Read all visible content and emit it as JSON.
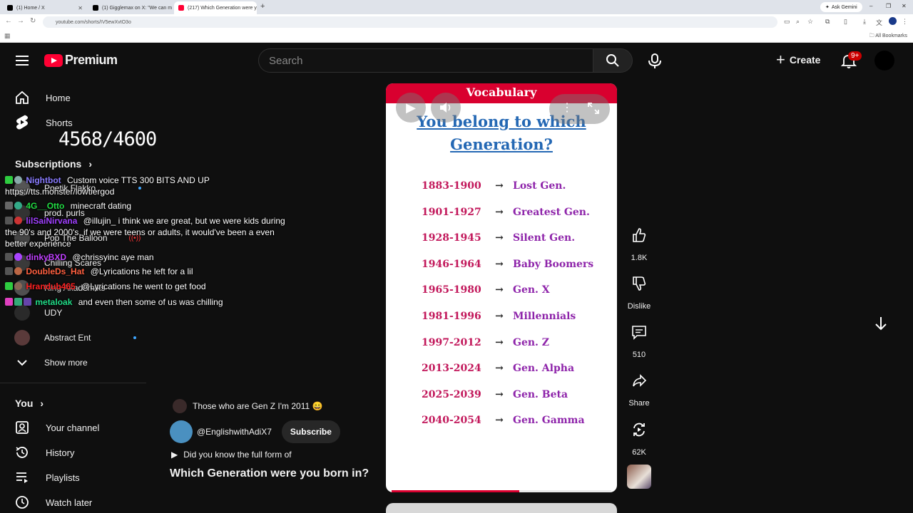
{
  "browser": {
    "tabs": [
      {
        "label": "(1) Home / X"
      },
      {
        "label": "(1) Gigglemax on X: \"We can m"
      },
      {
        "label": "(217) Which Generation were y"
      }
    ],
    "gemini_label": "Ask Gemini",
    "url": "youtube.com/shorts/IV5ewXvtO3o",
    "bookmarks_label": "All Bookmarks"
  },
  "header": {
    "brand": "Premium",
    "search_placeholder": "Search",
    "create_label": "Create",
    "notifications_badge": "9+"
  },
  "sidebar": {
    "nav": [
      {
        "label": "Home",
        "icon": "home-icon"
      },
      {
        "label": "Shorts",
        "icon": "shorts-icon"
      }
    ],
    "subscriptions_heading": "Subscriptions",
    "subscriptions": [
      {
        "label": "Poetik Flakko"
      },
      {
        "label": "prod. purls"
      },
      {
        "label": "Pop The Balloon"
      },
      {
        "label": "Chilling Scares"
      },
      {
        "label": "King Akademiks"
      },
      {
        "label": "UDY"
      },
      {
        "label": "Abstract Ent"
      }
    ],
    "show_more": "Show more",
    "you_heading": "You",
    "you_items": [
      {
        "label": "Your channel",
        "icon": "account-icon"
      },
      {
        "label": "History",
        "icon": "history-icon"
      },
      {
        "label": "Playlists",
        "icon": "playlists-icon"
      },
      {
        "label": "Watch later",
        "icon": "clock-icon"
      }
    ]
  },
  "overlay": {
    "counter": "4568/4600",
    "chat": [
      {
        "user": "Nightbot",
        "color": "#8a7cff",
        "text": "Custom voice TTS 300 BITS AND UP https://tts.monster/lowtiergod"
      },
      {
        "user": "4G__Otto",
        "color": "#22dd44",
        "text": "minecraft dating"
      },
      {
        "user": "lilSaiNirvana",
        "color": "#a040ff",
        "text": "@illujin_ i think we are great, but we were kids during the 90's and 2000's, if we were teens or adults, it would've been a even better experience"
      },
      {
        "user": "dinkyBXD",
        "color": "#c040ff",
        "text": "@chrissyinc  aye man"
      },
      {
        "user": "DoubleDs_Hat",
        "color": "#ff6040",
        "text": "@Lyrications he left for a lil"
      },
      {
        "user": "Hrandub465",
        "color": "#ff2222",
        "text": "@Lyrications he went to get food"
      },
      {
        "user": "metaloak",
        "color": "#22dd88",
        "text": "and even then some of us was chilling"
      }
    ]
  },
  "short": {
    "banner": "Vocabulary",
    "title_line1": "You belong to which",
    "title_line2": "Generation?",
    "generations": [
      {
        "years": "1883-1900",
        "arrow": "→",
        "name": "Lost Gen."
      },
      {
        "years": "1901-1927",
        "arrow": "→",
        "name": "Greatest Gen."
      },
      {
        "years": "1928-1945",
        "arrow": "→",
        "name": "Silent Gen."
      },
      {
        "years": "1946-1964",
        "arrow": "→",
        "name": "Baby Boomers"
      },
      {
        "years": "1965-1980",
        "arrow": "→",
        "name": "Gen. X"
      },
      {
        "years": "1981-1996",
        "arrow": "→",
        "name": "Millennials"
      },
      {
        "years": "1997-2012",
        "arrow": "→",
        "name": "Gen. Z"
      },
      {
        "years": "2013-2024",
        "arrow": "→",
        "name": "Gen. Alpha"
      },
      {
        "years": "2025-2039",
        "arrow": "→",
        "name": "Gen. Beta"
      },
      {
        "years": "2040-2054",
        "arrow": "→",
        "name": "Gen. Gamma"
      }
    ],
    "progress": 0.58,
    "pinned_comment": "Those who are Gen Z I'm 2011 😄",
    "channel": "@EnglishwithAdiX7",
    "subscribe_label": "Subscribe",
    "description": "Did you know the full form of",
    "video_title": "Which Generation were you born in?"
  },
  "actions": {
    "likes": "1.8K",
    "dislike_label": "Dislike",
    "comments": "510",
    "share_label": "Share",
    "remix": "62K"
  }
}
